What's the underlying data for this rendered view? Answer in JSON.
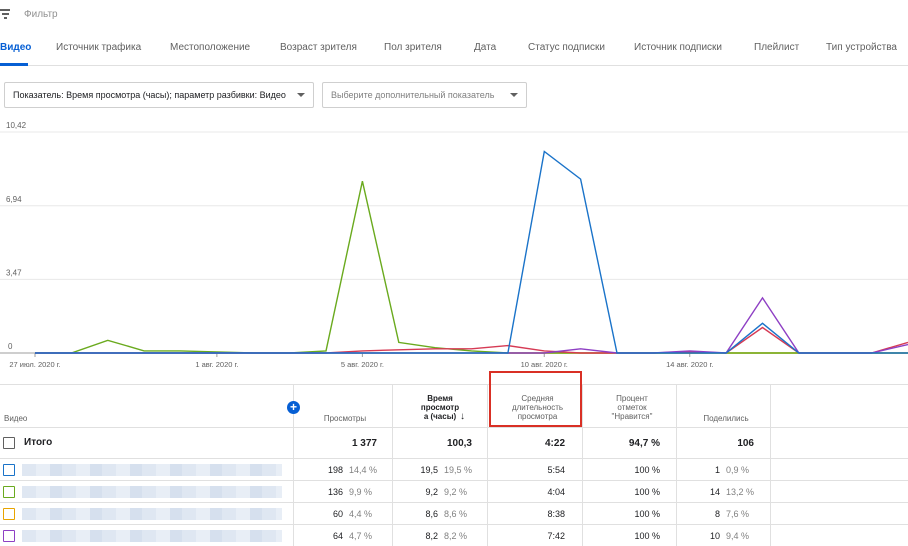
{
  "filter": {
    "placeholder": "Фильтр"
  },
  "tabs": [
    {
      "label": "Видео",
      "active": true
    },
    {
      "label": "Источник трафика"
    },
    {
      "label": "Местоположение"
    },
    {
      "label": "Возраст зрителя"
    },
    {
      "label": "Пол зрителя"
    },
    {
      "label": "Дата"
    },
    {
      "label": "Статус подписки"
    },
    {
      "label": "Источник подписки"
    },
    {
      "label": "Плейлист"
    },
    {
      "label": "Тип устройства"
    }
  ],
  "selectors": {
    "metric": "Показатель: Время просмотра (часы); параметр разбивки: Видео",
    "extra": "Выберите дополнительный показатель"
  },
  "colors": {
    "accent": "#065fd4",
    "highlight": "#d93025",
    "series_blue": "#1a73c9",
    "series_green": "#6aaa1e",
    "series_orange": "#e8a400",
    "series_purple": "#8e3fc4",
    "series_red": "#d63a54"
  },
  "chart_data": {
    "type": "line",
    "y_ticks": [
      "10,42",
      "6,94",
      "3,47",
      "0"
    ],
    "ylim": [
      0,
      10.42
    ],
    "x_ticks": [
      "27 июл. 2020 г.",
      "1 авг. 2020 г.",
      "5 авг. 2020 г.",
      "10 авг. 2020 г.",
      "14 авг. 2020 г."
    ],
    "x_days": [
      27,
      28,
      29,
      30,
      31,
      32,
      33,
      34,
      35,
      36,
      37,
      38,
      39,
      40,
      41,
      42,
      43,
      44,
      45,
      46,
      47,
      48,
      49,
      50,
      51
    ],
    "series": [
      {
        "color": "series_green",
        "values": [
          0,
          0,
          0.6,
          0.1,
          0.1,
          0.05,
          0,
          0,
          0.1,
          8.1,
          0.5,
          0.25,
          0.1,
          0,
          0,
          0,
          0,
          0,
          0,
          0,
          0,
          0,
          0,
          0,
          0
        ]
      },
      {
        "color": "series_blue",
        "values": [
          0,
          0,
          0,
          0,
          0,
          0,
          0,
          0,
          0,
          0,
          0,
          0,
          0,
          0,
          9.5,
          8.2,
          0,
          0,
          0,
          0,
          1.4,
          0,
          0,
          0,
          0
        ]
      },
      {
        "color": "series_purple",
        "values": [
          0,
          0,
          0,
          0,
          0,
          0,
          0,
          0,
          0,
          0,
          0,
          0,
          0,
          0,
          0,
          0.2,
          0,
          0,
          0.1,
          0,
          2.6,
          0,
          0,
          0,
          0.4
        ]
      },
      {
        "color": "series_red",
        "values": [
          0,
          0,
          0,
          0,
          0,
          0,
          0,
          0,
          0,
          0.1,
          0.15,
          0.2,
          0.2,
          0.35,
          0.1,
          0,
          0,
          0,
          0.05,
          0,
          1.2,
          0,
          0,
          0,
          0.5
        ]
      },
      {
        "color": "series_orange",
        "values": [
          0,
          0,
          0,
          0,
          0,
          0,
          0,
          0,
          0,
          0,
          0,
          0,
          0,
          0,
          0,
          0,
          0,
          0,
          0,
          0,
          0,
          0,
          0,
          0,
          0
        ]
      }
    ]
  },
  "table": {
    "headers": {
      "video": "Видео",
      "views": "Просмотры",
      "watch_time": [
        "Время",
        "просмотр",
        "а (часы)"
      ],
      "avg_duration": [
        "Средняя",
        "длительность",
        "просмотра"
      ],
      "likes_pct": [
        "Процент",
        "отметок",
        "\"Нравится\""
      ],
      "shares": "Поделились"
    },
    "total": {
      "label": "Итого",
      "views": "1 377",
      "watch_time": "100,3",
      "avg_duration": "4:22",
      "likes_pct": "94,7 %",
      "shares": "106"
    },
    "rows": [
      {
        "color": "series_blue",
        "views": "198",
        "views_pct": "14,4 %",
        "watch": "19,5",
        "watch_pct": "19,5 %",
        "avg": "5:54",
        "likes": "100 %",
        "shares": "1",
        "shares_pct": "0,9 %"
      },
      {
        "color": "series_green",
        "views": "136",
        "views_pct": "9,9 %",
        "watch": "9,2",
        "watch_pct": "9,2 %",
        "avg": "4:04",
        "likes": "100 %",
        "shares": "14",
        "shares_pct": "13,2 %"
      },
      {
        "color": "series_orange",
        "views": "60",
        "views_pct": "4,4 %",
        "watch": "8,6",
        "watch_pct": "8,6 %",
        "avg": "8:38",
        "likes": "100 %",
        "shares": "8",
        "shares_pct": "7,6 %"
      },
      {
        "color": "series_purple",
        "views": "64",
        "views_pct": "4,7 %",
        "watch": "8,2",
        "watch_pct": "8,2 %",
        "avg": "7:42",
        "likes": "100 %",
        "shares": "10",
        "shares_pct": "9,4 %"
      }
    ]
  }
}
